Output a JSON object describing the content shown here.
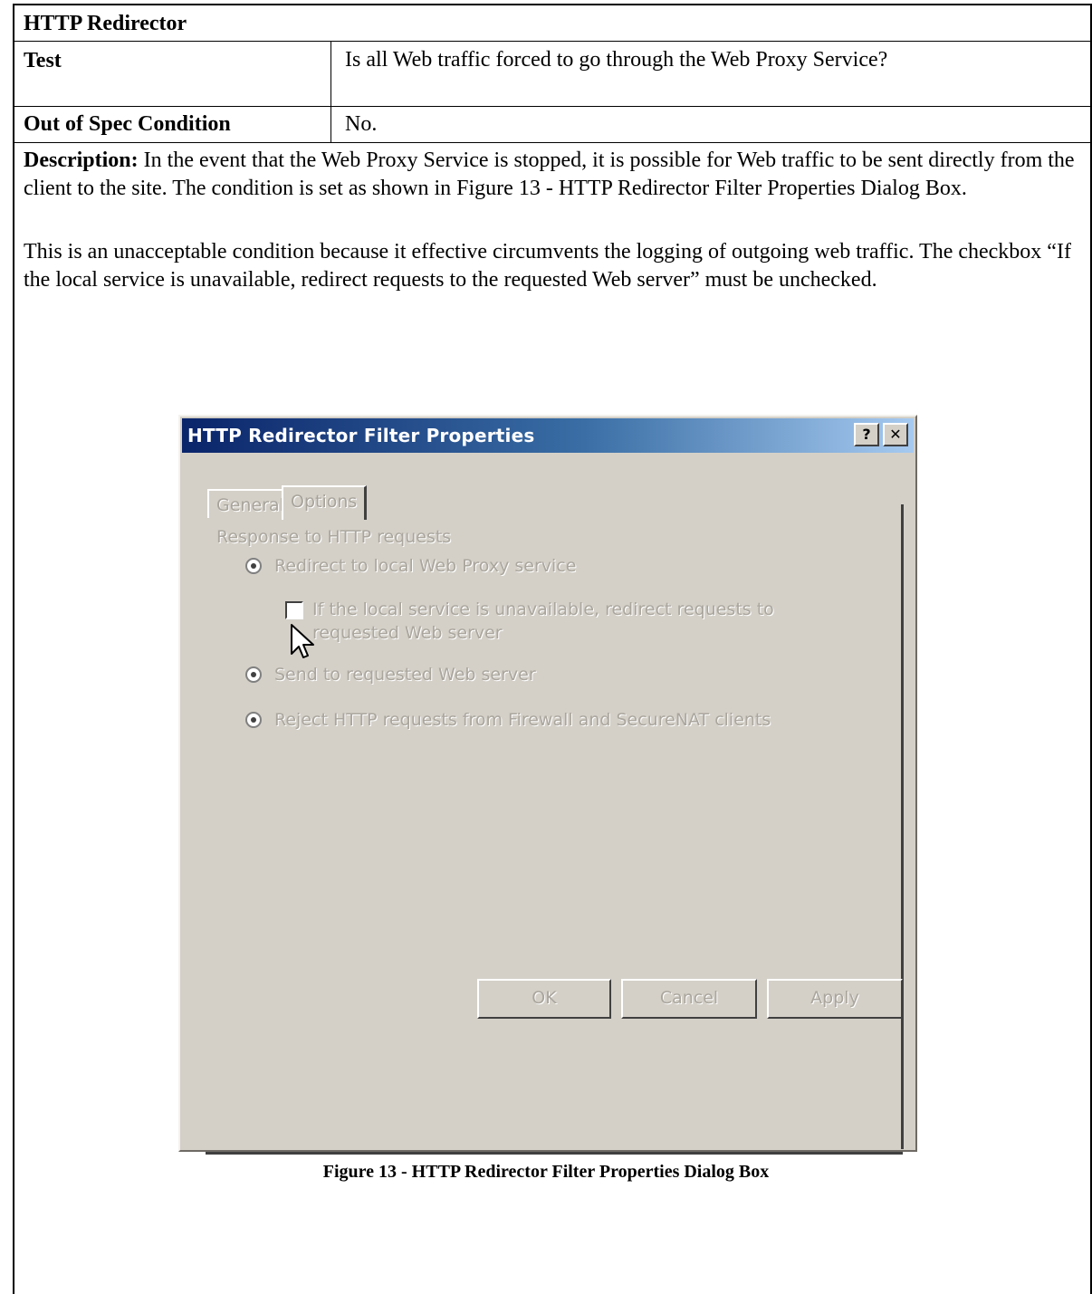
{
  "table": {
    "title": "HTTP Redirector",
    "test_label": "Test",
    "test_value": "Is all Web traffic forced to go through the Web Proxy Service?",
    "oos_label": "Out of Spec Condition",
    "oos_value": "No."
  },
  "description": {
    "label": "Description:",
    "text": " In the event that the Web Proxy Service is stopped, it is possible for Web traffic to be sent directly from the client to the site.  The condition is set as shown in Figure 13 - HTTP Redirector Filter Properties Dialog Box.",
    "paragraph2": "This is an unacceptable condition because it effective circumvents the logging of outgoing web traffic.  The checkbox “If the local service is unavailable, redirect requests to the requested Web server” must be unchecked."
  },
  "dialog": {
    "title": "HTTP Redirector Filter Properties",
    "help_glyph": "?",
    "close_glyph": "✕",
    "tabs": [
      "General",
      "Options"
    ],
    "group_label": "Response to HTTP requests",
    "options": {
      "redirect_local": "Redirect to local Web Proxy service",
      "fallback_checkbox_line1": "If the local service is unavailable, redirect requests to",
      "fallback_checkbox_line2": "requested Web server",
      "send_requested": "Send to requested Web server",
      "reject": "Reject HTTP requests from Firewall and SecureNAT clients"
    },
    "buttons": {
      "ok": "OK",
      "cancel": "Cancel",
      "apply": "Apply"
    }
  },
  "caption": "Figure 13 - HTTP Redirector Filter Properties Dialog Box"
}
